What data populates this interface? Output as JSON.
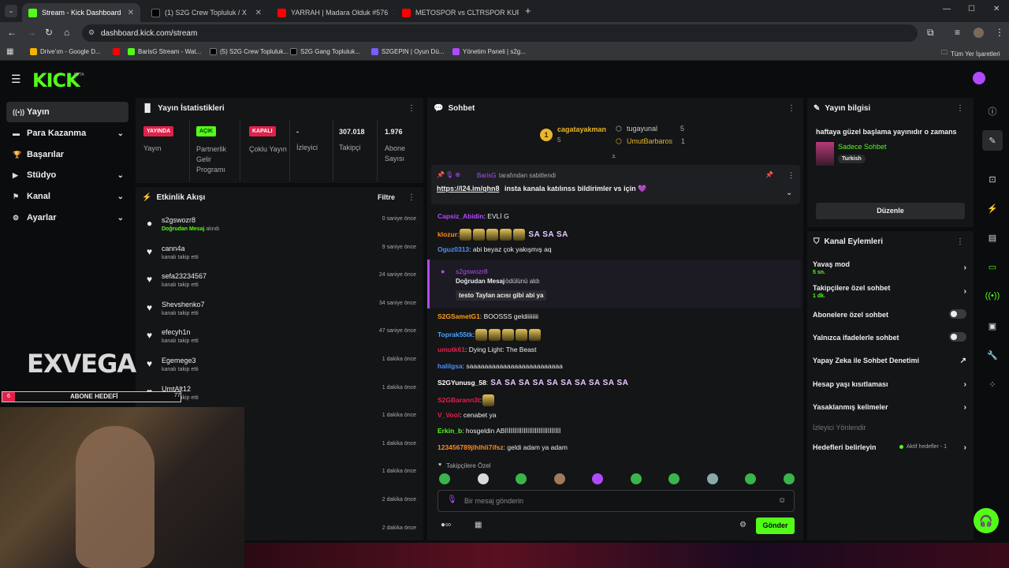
{
  "browser": {
    "tabs": [
      {
        "title": "Stream - Kick Dashboard",
        "color": "#53fc18"
      },
      {
        "title": "(1) S2G Crew Topluluk / X",
        "color": "#000000"
      },
      {
        "title": "YARRAH | Madara Olduk #576",
        "color": "#ff0000"
      },
      {
        "title": "METOSPOR vs CLTRSPOR KUPA",
        "color": "#ff0000"
      }
    ],
    "url": "dashboard.kick.com/stream",
    "bookmarks": [
      {
        "label": "Drive'ım - Google D...",
        "color": "#f4b400"
      },
      {
        "label": "",
        "color": "#ff0000"
      },
      {
        "label": "BarisG Stream - Wat...",
        "color": "#53fc18"
      },
      {
        "label": "(5) S2G Crew Topluluk...",
        "color": "#000000"
      },
      {
        "label": "S2G Gang Topluluk...",
        "color": "#000000"
      },
      {
        "label": "S2GEPIN | Oyun Dü...",
        "color": "#7b5cff"
      },
      {
        "label": "Yönetim Paneli | s2g...",
        "color": "#b04aff"
      }
    ],
    "bookmarks_right": "Tüm Yer İşaretleri"
  },
  "header": {
    "logo": "KICK",
    "beta": "BETA"
  },
  "sidebar": {
    "items": [
      {
        "label": "Yayın",
        "icon": "((•))",
        "chev": false
      },
      {
        "label": "Para Kazanma",
        "icon": "▬",
        "chev": true
      },
      {
        "label": "Başarılar",
        "icon": "🏆",
        "chev": false
      },
      {
        "label": "Stüdyo",
        "icon": "▶",
        "chev": true
      },
      {
        "label": "Kanal",
        "icon": "⚑",
        "chev": true
      },
      {
        "label": "Ayarlar",
        "icon": "⚙",
        "chev": true
      }
    ]
  },
  "stats": {
    "title": "Yayın İstatistikleri",
    "items": [
      {
        "badge": "YAYINDA",
        "label": "Yayın",
        "badge_color": "#e0224a"
      },
      {
        "badge": "AÇIK",
        "label": "Partnerlik Gelir Programı",
        "badge_color": "#53fc18"
      },
      {
        "badge": "KAPALI",
        "label": "Çoklu Yayın",
        "badge_color": "#e0224a"
      },
      {
        "value": "-",
        "label": "İzleyici"
      },
      {
        "value": "307.018",
        "label": "Takipçi"
      },
      {
        "value": "1.976",
        "label": "Abone Sayısı"
      }
    ]
  },
  "activity": {
    "title": "Etkinlik Akışı",
    "filter": "Filtre",
    "items": [
      {
        "name": "s2gswozr8",
        "sub_hl": "Doğrudan Mesaj",
        "sub": " alındı",
        "time": "0 saniye önce"
      },
      {
        "name": "cann4a",
        "sub": "kanalı takip etti",
        "time": "9 saniye önce"
      },
      {
        "name": "sefa23234567",
        "sub": "kanalı takip etti",
        "time": "24 saniye önce"
      },
      {
        "name": "Shevshenko7",
        "sub": "kanalı takip etti",
        "time": "34 saniye önce"
      },
      {
        "name": "efecyh1n",
        "sub": "kanalı takip etti",
        "time": "47 saniye önce"
      },
      {
        "name": "Egemege3",
        "sub": "kanalı takip etti",
        "time": "1 dakika önce"
      },
      {
        "name": "UmtAlt12",
        "sub": "kanalı takip etti",
        "time": "1 dakika önce"
      },
      {
        "name": "",
        "sub": "",
        "time": "1 dakika önce"
      },
      {
        "name": "",
        "sub": "",
        "time": "1 dakika önce"
      },
      {
        "name": "",
        "sub": "",
        "time": "1 dakika önce"
      },
      {
        "name": "",
        "sub": "",
        "time": "2 dakika önce"
      },
      {
        "name": "",
        "sub": "",
        "time": "2 dakika önce"
      }
    ]
  },
  "overlay": {
    "brand": "EXVEGA",
    "goal_label": "ABONE HEDEFİ",
    "goal_count": "6",
    "goal_target": "77"
  },
  "chat": {
    "title": "Sohbet",
    "leaders": [
      {
        "rank": "1",
        "name": "cagatayakman",
        "count": "5"
      },
      {
        "name": "tugayunal",
        "count": "5"
      },
      {
        "name": "UmutBarbaros",
        "count": "1"
      }
    ],
    "pinned": {
      "user": "BarisG",
      "by": " tarafından sabitlendi",
      "link": "https://l24.im/qhn8",
      "text": " insta kanala katılınss bildirimler vs için 💜"
    },
    "messages": [
      {
        "user": "Capsiz_Abidin",
        "color": "#b04aff",
        "text": ": EVLİ G"
      },
      {
        "user": "klozur",
        "color": "#ff8c1a",
        "text": ":",
        "emotes": 5,
        "sasa": "SA SA SA"
      },
      {
        "user": "Oguz0313",
        "color": "#4a90ff",
        "text": ": abi beyaz çok yakışmış aq"
      },
      {
        "user": "S2GSametG1",
        "color": "#ff9f1a",
        "text": ": BOOSSS geldiiiiiiii"
      },
      {
        "user": "Toprak55tk",
        "color": "#4aa3ff",
        "text": ":",
        "emotes": 5
      },
      {
        "user": "umutk61",
        "color": "#e0224a",
        "text": ": Dying Light: The Beast"
      },
      {
        "user": "halilgsa",
        "color": "#4a90ff",
        "text": ": saaaaaaaaaaaaaaaaaaaaaaaaa"
      },
      {
        "user": "S2GYunusg_58",
        "color": "#ffffff",
        "text": ":",
        "sasa": "SA SA SA SA SA SA SA SA SA SA"
      },
      {
        "user": "S2GBarann3t",
        "color": "#e0224a",
        "text": ":",
        "emotes": 1
      },
      {
        "user": "V_Vool",
        "color": "#e0224a",
        "text": ": cenabet ya"
      },
      {
        "user": "Erkin_b",
        "color": "#53fc18",
        "text": ": hosgeldin ABİİİİİİİİİİİİİİİİİİİİİİİİİİİİİİ"
      },
      {
        "user": "123456789jlhlhli7ifsz",
        "color": "#ff8c1a",
        "text": ": geldi adam ya adam"
      }
    ],
    "dm": {
      "user": "s2gswozr8",
      "label": "Doğrudan Mesaj",
      "rest": " ödülünü aldı",
      "body": "testo Taylan acısı gibi abi ya"
    },
    "followers_only": "Takipçilere Özel",
    "placeholder": "Bir mesaj gönderin",
    "send": "Gönder"
  },
  "info": {
    "title": "Yayın bilgisi",
    "stream_title": "haftaya güzel başlama yayınıdır o zamans",
    "category": "Sadece Sohbet",
    "language": "Turkish",
    "edit": "Düzenle"
  },
  "actions": {
    "title": "Kanal Eylemleri",
    "items": [
      {
        "label": "Yavaş mod",
        "small": "5 sn.",
        "type": "arrow"
      },
      {
        "label": "Takipçilere özel sohbet",
        "small": "1 dk.",
        "type": "arrow"
      },
      {
        "label": "Abonelere özel sohbet",
        "type": "toggle"
      },
      {
        "label": "Yalnızca ifadelerle sohbet",
        "type": "toggle"
      },
      {
        "label": "Yapay Zeka ile Sohbet Denetimi",
        "type": "ext"
      },
      {
        "label": "Hesap yaşı kısıtlaması",
        "type": "arrow"
      },
      {
        "label": "Yasaklanmış kelimeler",
        "type": "arrow"
      }
    ],
    "section": "İzleyici Yönlendir",
    "goals_label": "Hedefleri belirleyin",
    "goals_status": "Aktif hedefler - 1"
  }
}
